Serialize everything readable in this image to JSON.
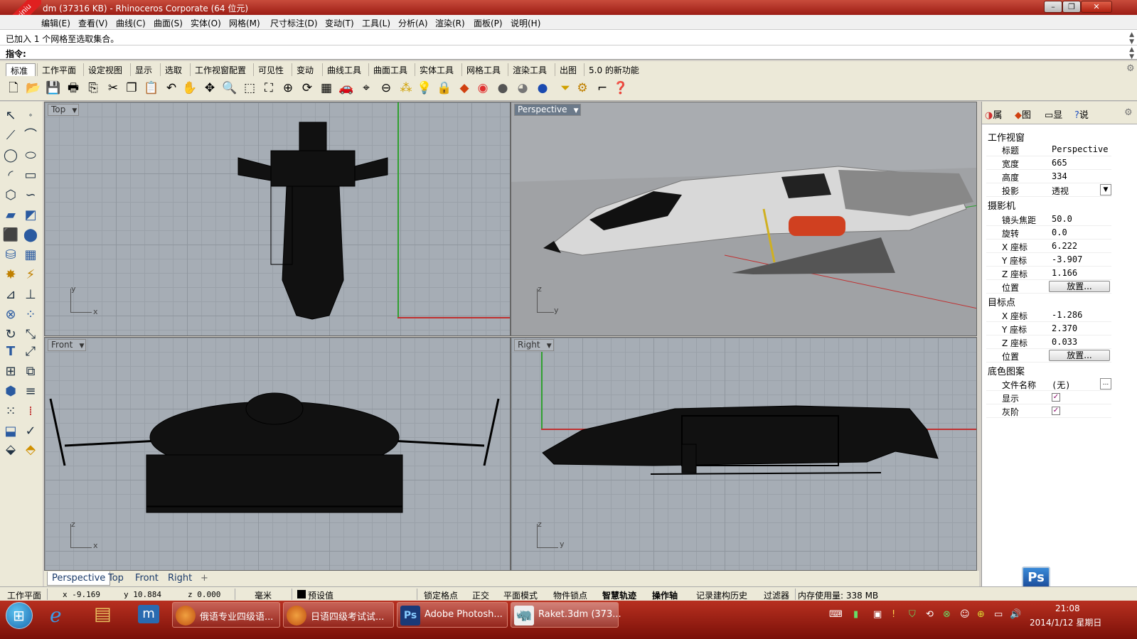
{
  "title": "dm (37316 KB) - Rhinoceros Corporate (64 位元)",
  "watermark": "xuexiniu 学犀牛中文网",
  "menu": [
    "编辑(E)",
    "查看(V)",
    "曲线(C)",
    "曲面(S)",
    "实体(O)",
    "网格(M)",
    "尺寸标注(D)",
    "变动(T)",
    "工具(L)",
    "分析(A)",
    "渲染(R)",
    "面板(P)",
    "说明(H)"
  ],
  "command_history": "已加入 1 个网格至选取集合。",
  "command_prompt": "指令:",
  "toolbar_tabs": [
    "标准",
    "工作平面",
    "设定视图",
    "显示",
    "选取",
    "工作视窗配置",
    "可见性",
    "变动",
    "曲线工具",
    "曲面工具",
    "实体工具",
    "网格工具",
    "渲染工具",
    "出图",
    "5.0 的新功能"
  ],
  "viewports": {
    "top": "Top",
    "perspective": "Perspective",
    "front": "Front",
    "right": "Right"
  },
  "axis_labels": {
    "x": "x",
    "y": "y",
    "z": "z"
  },
  "viewport_tabs": [
    "Perspective",
    "Top",
    "Front",
    "Right"
  ],
  "panel": {
    "tabs": [
      "属",
      "图",
      "显",
      "说"
    ],
    "section_viewport": "工作视窗",
    "viewport_rows": [
      {
        "k": "标题",
        "v": "Perspective"
      },
      {
        "k": "宽度",
        "v": "665"
      },
      {
        "k": "高度",
        "v": "334"
      },
      {
        "k": "投影",
        "v": "透视"
      }
    ],
    "section_camera": "摄影机",
    "camera_rows": [
      {
        "k": "镜头焦距",
        "v": "50.0"
      },
      {
        "k": "旋转",
        "v": "0.0"
      },
      {
        "k": "X 座标",
        "v": "6.222"
      },
      {
        "k": "Y 座标",
        "v": "-3.907"
      },
      {
        "k": "Z 座标",
        "v": "1.166"
      },
      {
        "k": "位置",
        "v": "放置..."
      }
    ],
    "section_target": "目标点",
    "target_rows": [
      {
        "k": "X 座标",
        "v": "-1.286"
      },
      {
        "k": "Y 座标",
        "v": "2.370"
      },
      {
        "k": "Z 座标",
        "v": "0.033"
      },
      {
        "k": "位置",
        "v": "放置..."
      }
    ],
    "section_wallpaper": "底色图案",
    "wallpaper_rows": [
      {
        "k": "文件名称",
        "v": "(无)"
      },
      {
        "k": "显示",
        "v": "✓"
      },
      {
        "k": "灰阶",
        "v": "✓"
      }
    ]
  },
  "status": {
    "cplane": "工作平面",
    "x": "x -9.169",
    "y": "y 10.884",
    "z": "z 0.000",
    "units": "毫米",
    "layer": "预设值",
    "toggles": [
      "锁定格点",
      "正交",
      "平面模式",
      "物件锁点",
      "智慧轨迹",
      "操作轴",
      "记录建构历史",
      "过滤器"
    ],
    "memory": "内存使用量: 338 MB"
  },
  "taskbar": {
    "tasks": [
      "俄语专业四级语...",
      "日语四级考试试...",
      "Adobe Photosh...",
      "Raket.3dm (373..."
    ],
    "time": "21:08",
    "date": "2014/1/12 星期日"
  },
  "ps_badge": "Ps",
  "colors": {
    "accent_red": "#b02010",
    "viewport_bg": "#a6adb5",
    "x_axis": "#c03030",
    "y_axis": "#30a030"
  }
}
